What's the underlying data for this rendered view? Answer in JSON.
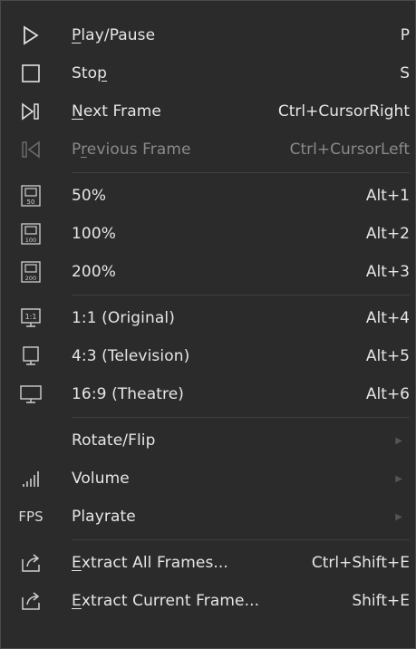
{
  "menu": {
    "groups": [
      {
        "items": [
          {
            "icon": "play-icon",
            "pre": "",
            "u": "P",
            "post": "lay/Pause",
            "shortcut": "P",
            "disabled": false
          },
          {
            "icon": "stop-icon",
            "pre": "Sto",
            "u": "p",
            "post": "",
            "shortcut": "S",
            "disabled": false
          },
          {
            "icon": "next-frame-icon",
            "pre": "",
            "u": "N",
            "post": "ext Frame",
            "shortcut": "Ctrl+CursorRight",
            "disabled": false
          },
          {
            "icon": "previous-frame-icon",
            "pre": "P",
            "u": "r",
            "post": "evious Frame",
            "shortcut": "Ctrl+CursorLeft",
            "disabled": true
          }
        ]
      },
      {
        "items": [
          {
            "icon": "zoom-50-icon",
            "label": "50%",
            "shortcut": "Alt+1"
          },
          {
            "icon": "zoom-100-icon",
            "label": "100%",
            "shortcut": "Alt+2"
          },
          {
            "icon": "zoom-200-icon",
            "label": "200%",
            "shortcut": "Alt+3"
          }
        ]
      },
      {
        "items": [
          {
            "icon": "aspect-original-icon",
            "label": "1:1 (Original)",
            "shortcut": "Alt+4"
          },
          {
            "icon": "aspect-television-icon",
            "label": "4:3 (Television)",
            "shortcut": "Alt+5"
          },
          {
            "icon": "aspect-theatre-icon",
            "label": "16:9 (Theatre)",
            "shortcut": "Alt+6"
          }
        ]
      },
      {
        "items": [
          {
            "icon": "",
            "label": "Rotate/Flip",
            "submenu": true
          },
          {
            "icon": "volume-icon",
            "label": "Volume",
            "submenu": true
          },
          {
            "icon": "fps-icon",
            "icon_text": "FPS",
            "label": "Playrate",
            "submenu": true
          }
        ]
      },
      {
        "items": [
          {
            "icon": "extract-all-frames-icon",
            "u": "E",
            "post": "xtract All Frames...",
            "shortcut": "Ctrl+Shift+E"
          },
          {
            "icon": "extract-current-frame-icon",
            "u": "E",
            "post": "xtract Current Frame...",
            "shortcut": "Shift+E"
          }
        ]
      }
    ]
  }
}
